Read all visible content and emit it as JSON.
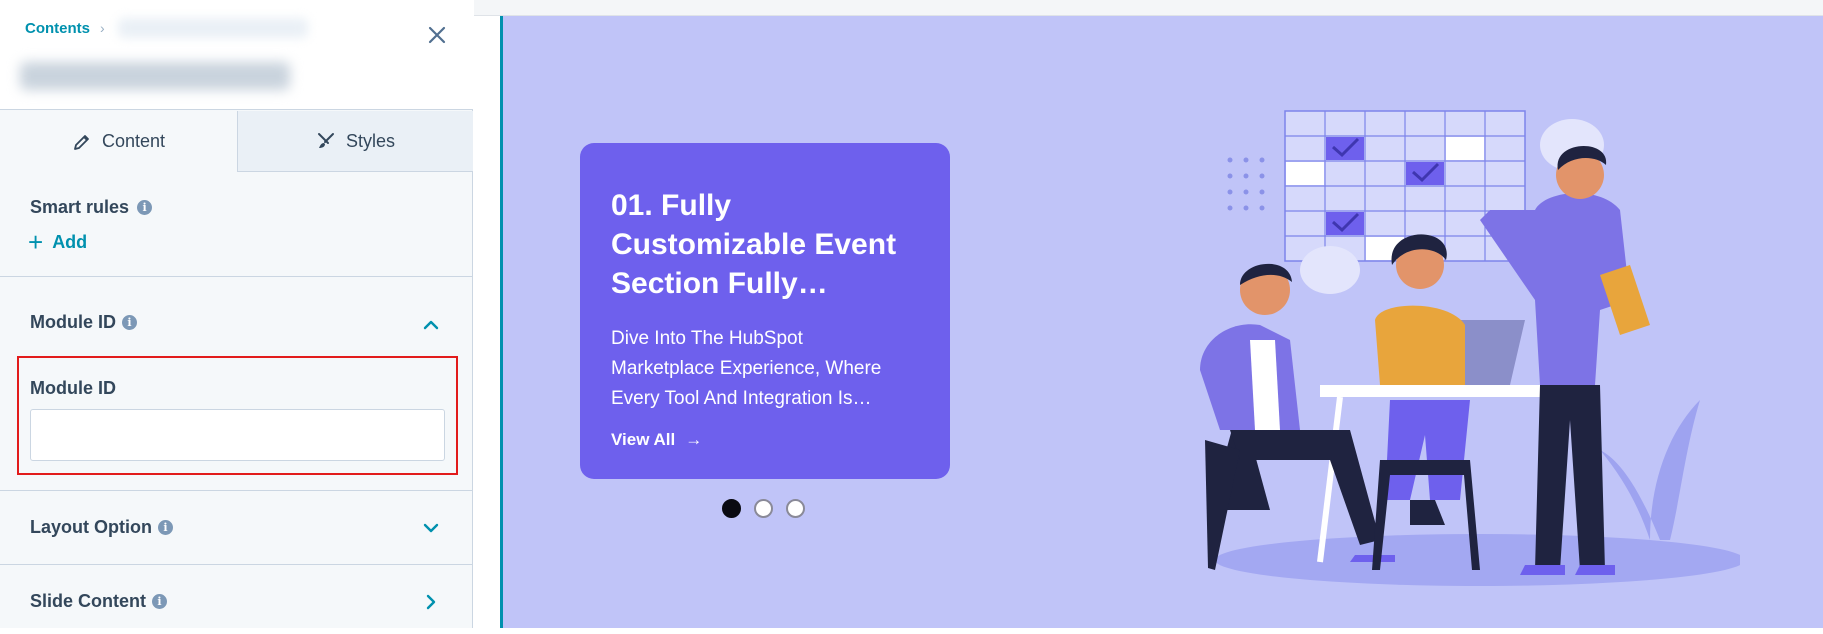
{
  "breadcrumb": {
    "root": "Contents",
    "separator": "›"
  },
  "tabs": [
    {
      "label": "Content",
      "icon": "pencil-icon"
    },
    {
      "label": "Styles",
      "icon": "brush-icon"
    }
  ],
  "smart_rules": {
    "title": "Smart rules",
    "add_label": "Add"
  },
  "sections": {
    "module_id": {
      "title": "Module ID",
      "field_label": "Module ID",
      "value": "",
      "expanded": true
    },
    "layout_option": {
      "title": "Layout Option"
    },
    "slide_content": {
      "title": "Slide Content"
    }
  },
  "colors": {
    "accent": "#0091ae",
    "highlight": "#e21b1b",
    "card": "#6e60ed",
    "preview_bg": "#c0c4f8"
  },
  "slide": {
    "title": "01. Fully Customizable Event Section Fully…",
    "description": "Dive Into The HubSpot Marketplace Experience, Where Every Tool And Integration Is…",
    "link_label": "View All",
    "link_arrow": "→",
    "current_index": 1,
    "total_slides": 3
  }
}
